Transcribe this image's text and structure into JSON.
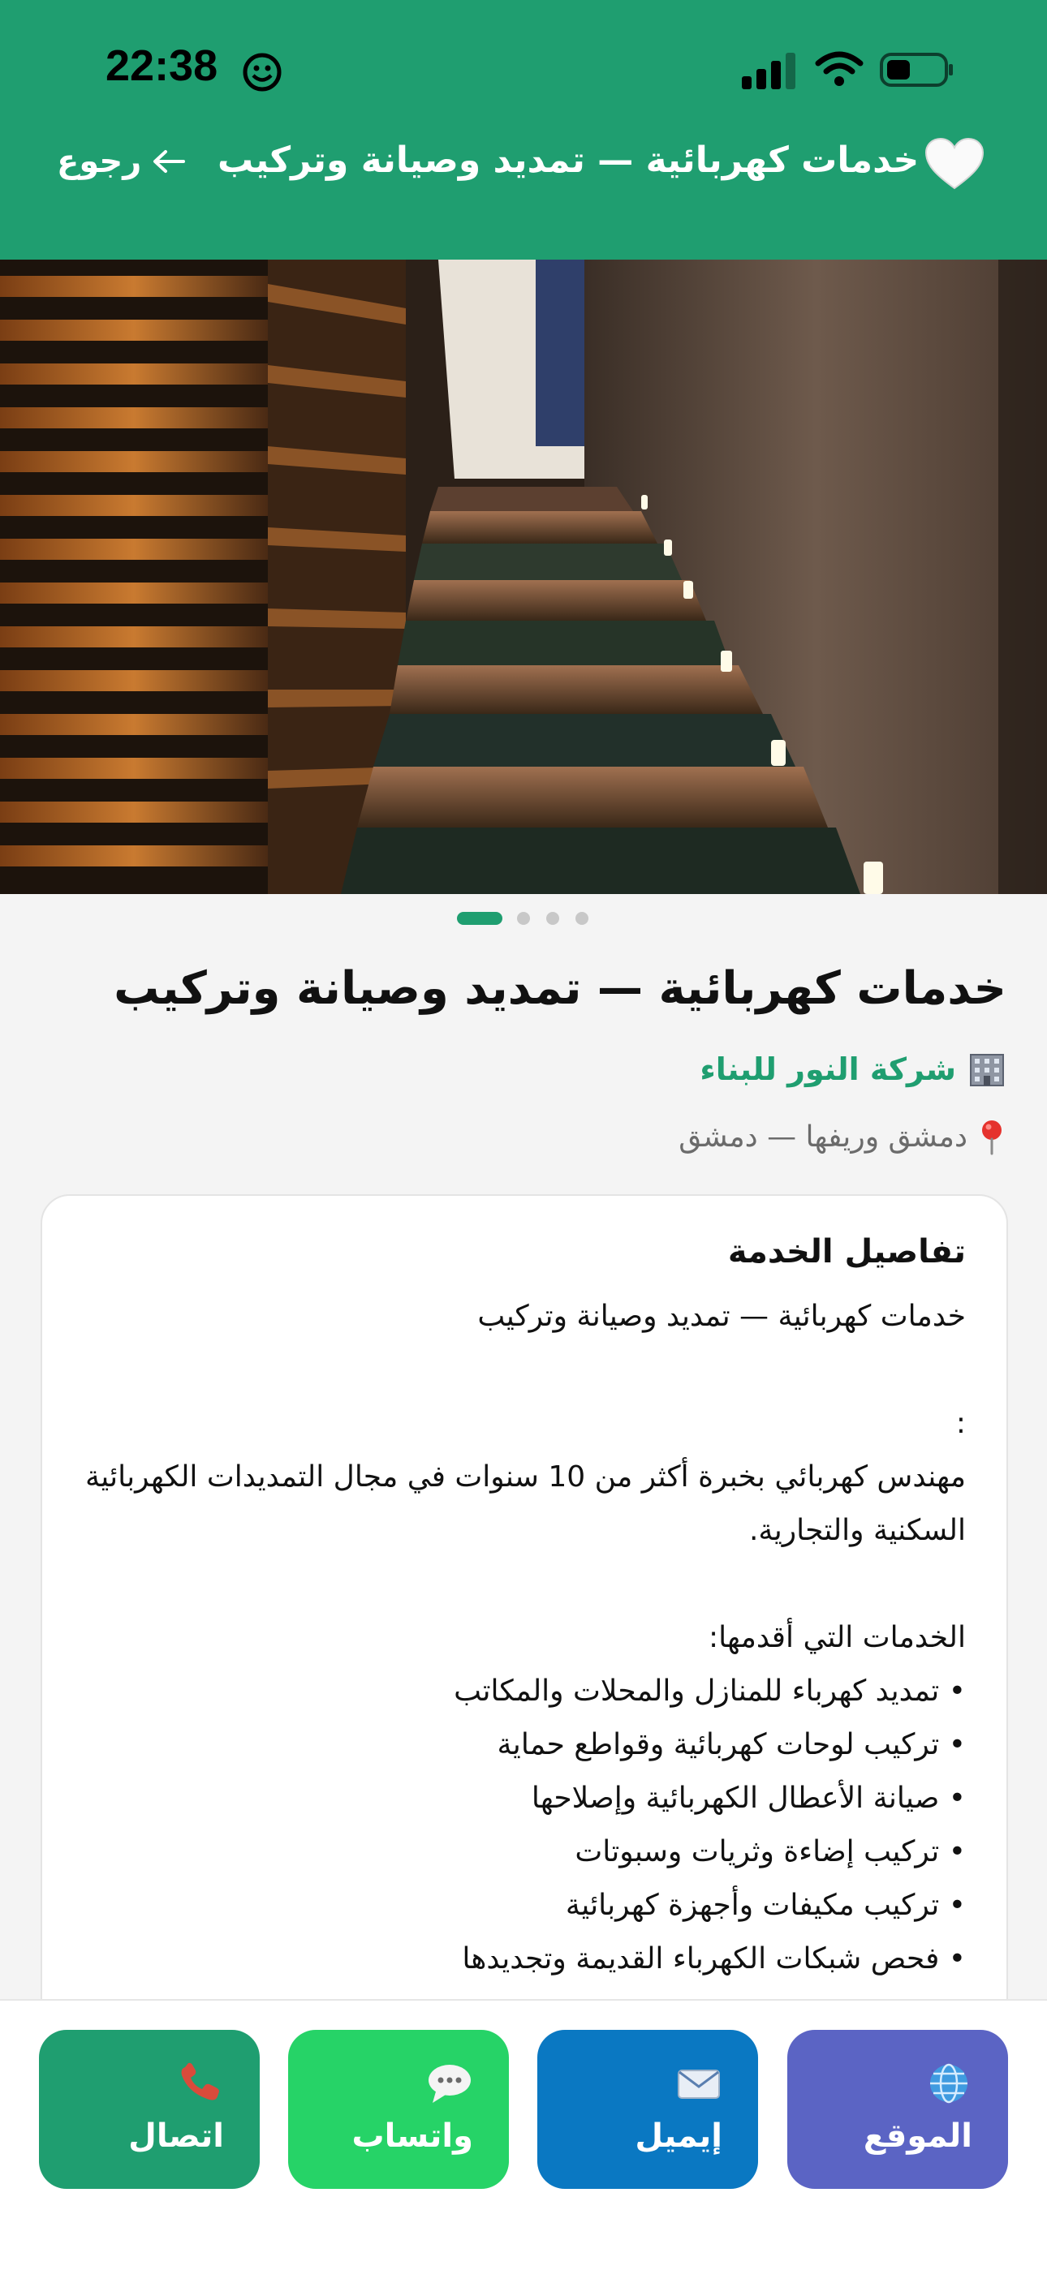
{
  "status_bar": {
    "time": "22:38"
  },
  "header": {
    "title": "خدمات كهربائية — تمديد وصيانة وتركيب",
    "back_label": "رجوع",
    "icons": [
      "heart-icon",
      "back-arrow-icon"
    ]
  },
  "carousel": {
    "count": 4,
    "active_index": 0
  },
  "listing": {
    "title": "خدمات كهربائية — تمديد وصيانة وتركيب",
    "company": "شركة النور للبناء",
    "location": "دمشق وريفها — دمشق"
  },
  "details": {
    "heading": "تفاصيل الخدمة",
    "line1": "خدمات كهربائية — تمديد وصيانة وتركيب",
    "colon": ":",
    "intro": "مهندس كهربائي بخبرة أكثر من 10 سنوات في مجال التمديدات الكهربائية السكنية والتجارية.",
    "services_heading": "الخدمات التي أقدمها:",
    "services": [
      "• تمديد كهرباء للمنازل والمحلات والمكاتب",
      "• تركيب لوحات كهربائية وقواطع حماية",
      "• صيانة الأعطال الكهربائية وإصلاحها",
      "• تركيب إضاءة وثريات وسبوتات",
      "• تركيب مكيفات وأجهزة كهربائية",
      "• فحص شبكات الكهرباء القديمة وتجديدها"
    ]
  },
  "actions": {
    "website": "الموقع",
    "email": "إيميل",
    "whatsapp": "واتساب",
    "call": "اتصال"
  },
  "colors": {
    "brand": "#1f9e70",
    "website": "#5b64c4",
    "email": "#0a78c2",
    "whatsapp": "#26d367"
  }
}
